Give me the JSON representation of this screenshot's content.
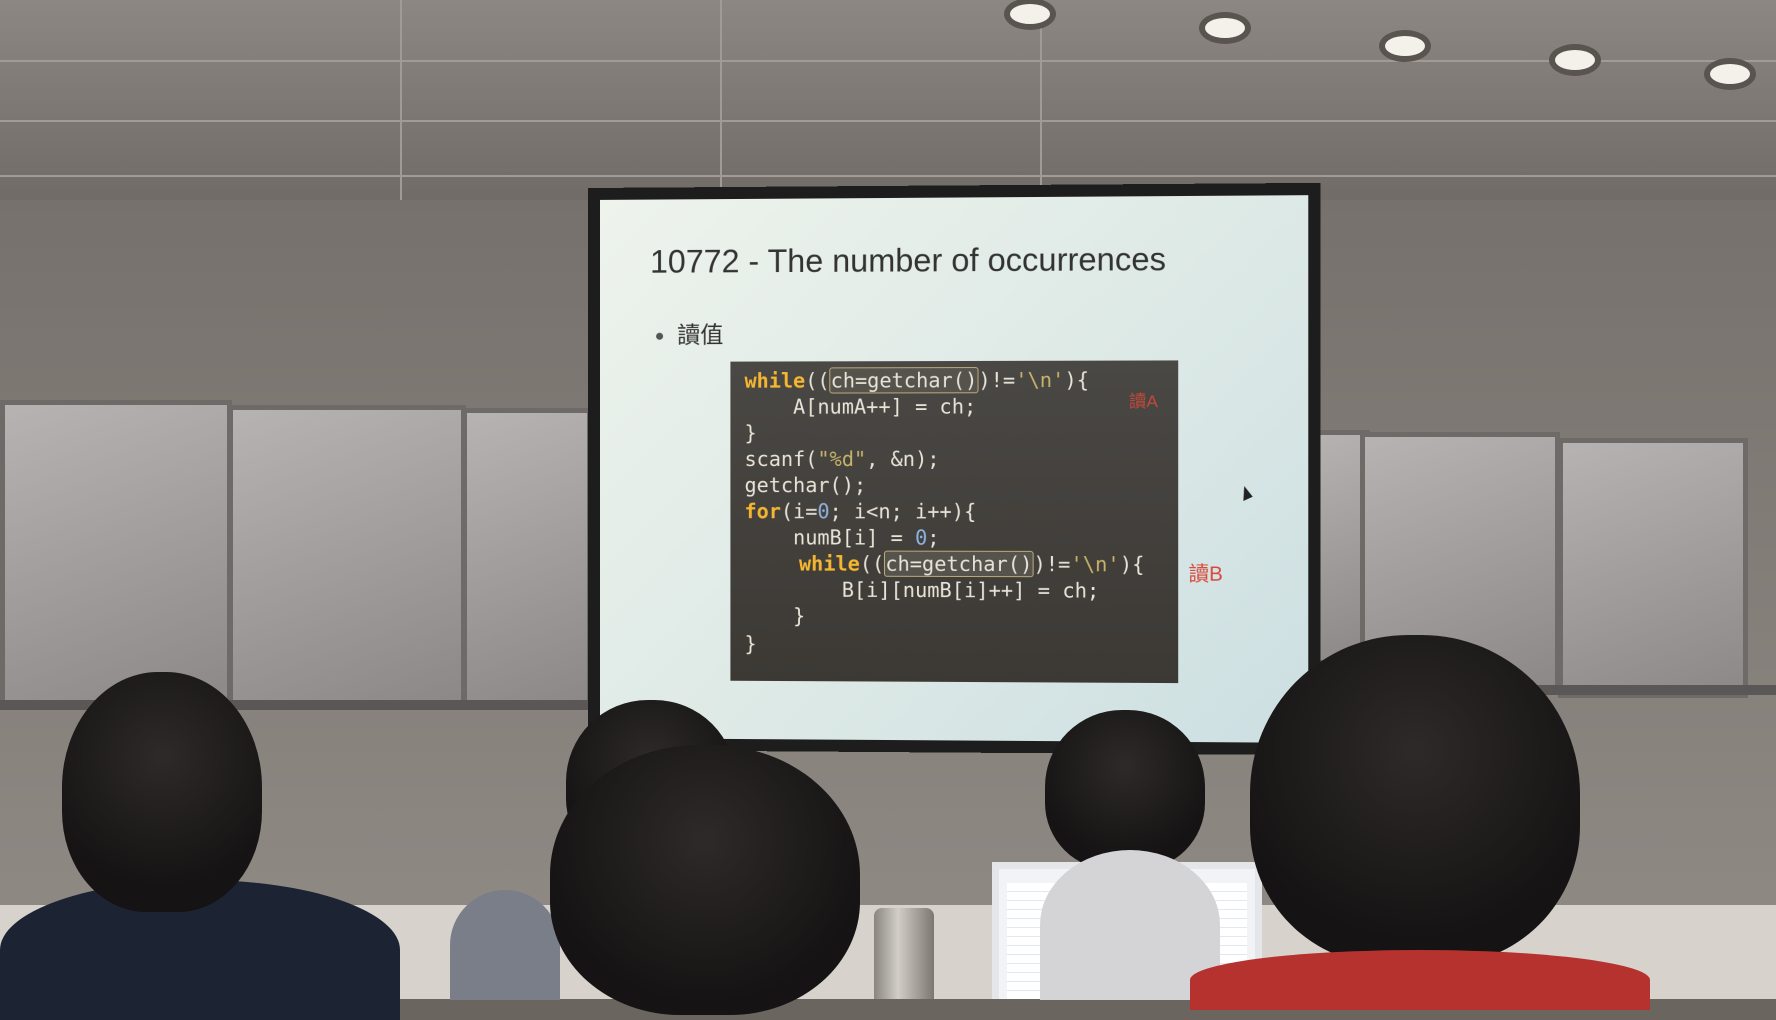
{
  "slide": {
    "title": "10772 - The number of occurrences",
    "bullet": "讀值",
    "note_a": "讀A",
    "note_b": "讀B"
  },
  "code": {
    "l1_kw": "while",
    "l1_a": "((",
    "l1_hl": "ch=getchar()",
    "l1_b": ")!=",
    "l1_str": "'\\n'",
    "l1_c": "){",
    "l2": "    A[numA++] = ch;",
    "l3": "}",
    "l4_a": "scanf(",
    "l4_str": "\"%d\"",
    "l4_b": ", &n);",
    "l5": "getchar();",
    "l6_kw": "for",
    "l6_a": "(i=",
    "l6_n1": "0",
    "l6_b": "; i<n; i++){",
    "l7_a": "    numB[i] = ",
    "l7_n": "0",
    "l7_b": ";",
    "l8_kw": "while",
    "l8_a": "((",
    "l8_hl": "ch=getchar()",
    "l8_b": ")!=",
    "l8_str": "'\\n'",
    "l8_c": "){",
    "l9": "        B[i][numB[i]++] = ch;",
    "l10": "    }",
    "l11": "}"
  },
  "colors": {
    "slide_bg": "#e4eeea",
    "code_bg": "#423f3b",
    "keyword": "#f5b731",
    "annotation": "#d9493a"
  }
}
